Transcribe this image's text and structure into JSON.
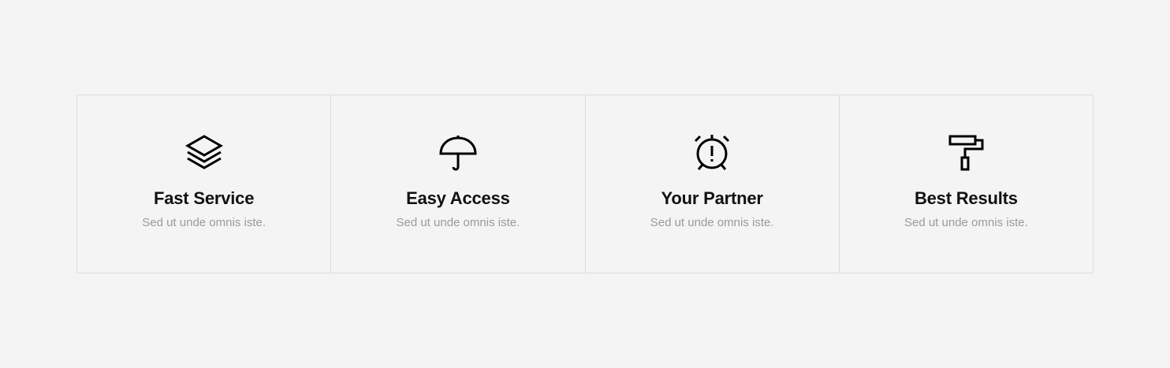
{
  "colors": {
    "background": "#f4f4f4",
    "border": "#dcdcdc",
    "title": "#111111",
    "description": "#9a9a9a",
    "icon": "#000000"
  },
  "features": [
    {
      "icon": "layers-icon",
      "title": "Fast Service",
      "description": "Sed ut unde omnis iste."
    },
    {
      "icon": "umbrella-icon",
      "title": "Easy Access",
      "description": "Sed ut unde omnis iste."
    },
    {
      "icon": "alarm-clock-icon",
      "title": "Your Partner",
      "description": "Sed ut unde omnis iste."
    },
    {
      "icon": "paint-roller-icon",
      "title": "Best Results",
      "description": "Sed ut unde omnis iste."
    }
  ]
}
